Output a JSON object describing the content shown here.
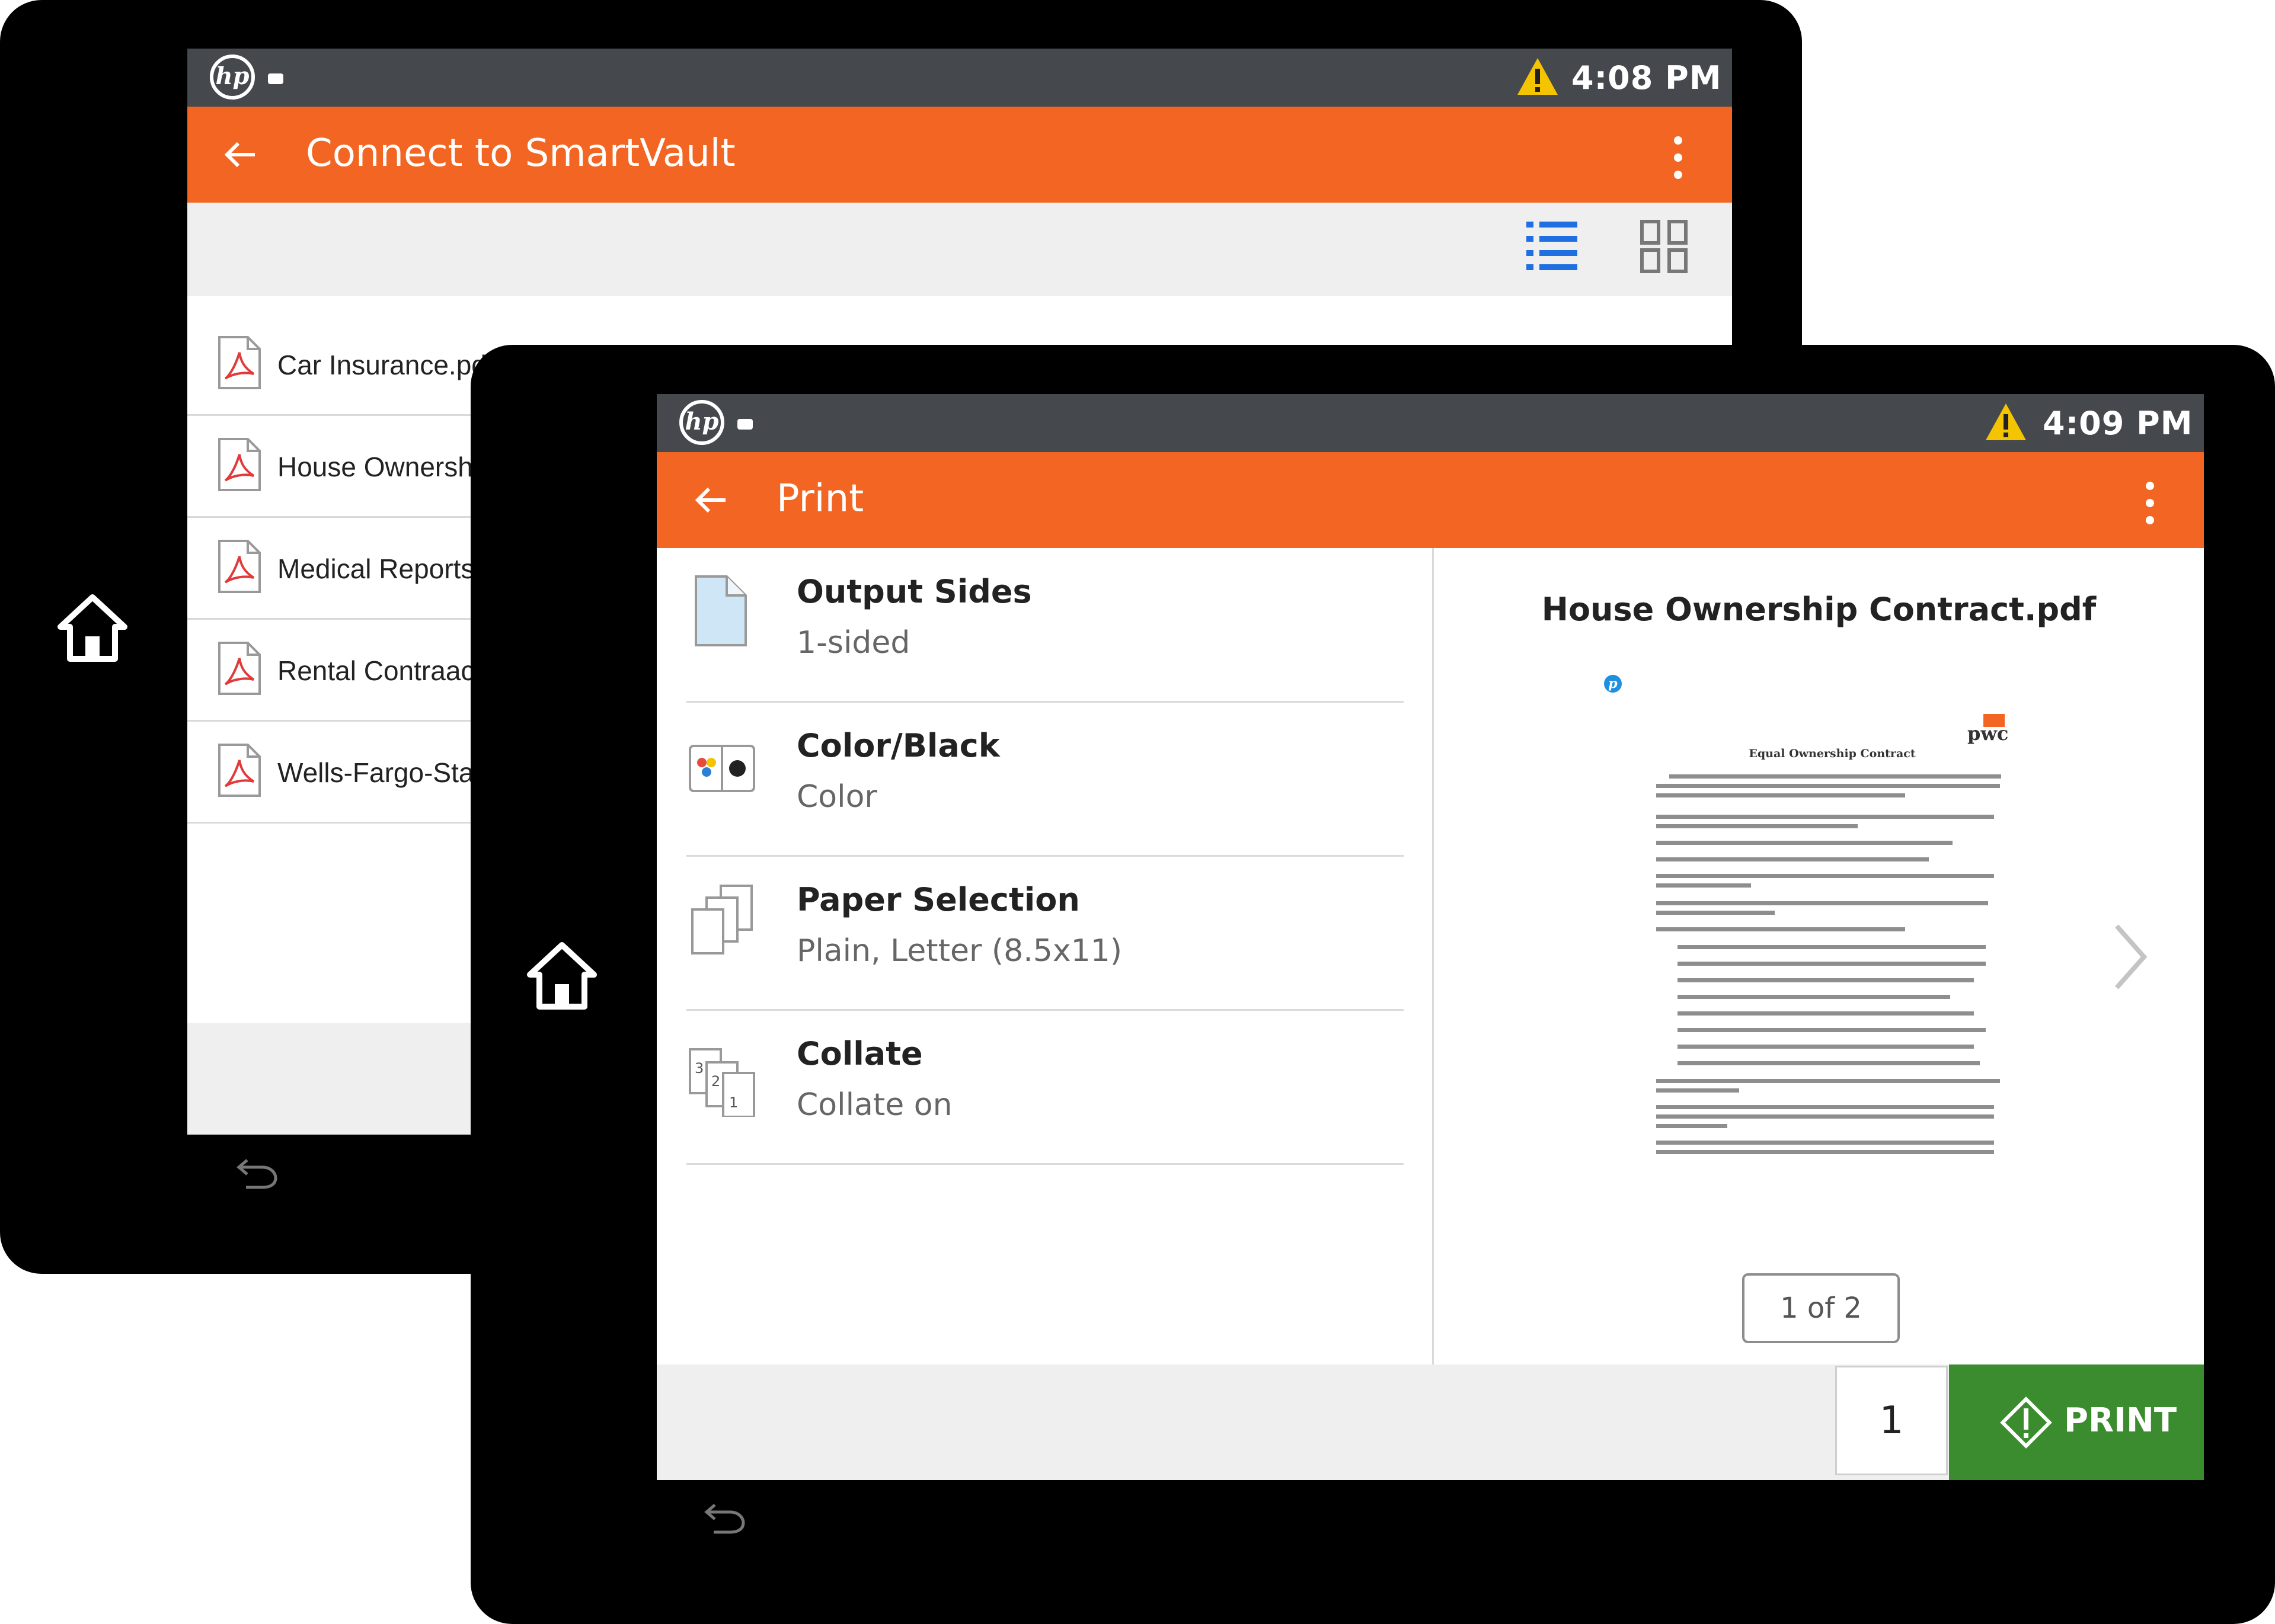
{
  "back_screen": {
    "status": {
      "time": "4:08 PM"
    },
    "title": "Connect to SmartVault",
    "files": [
      {
        "name": "Car Insurance.pdf"
      },
      {
        "name": "House Ownership Contract.pdf"
      },
      {
        "name": "Medical Reports.pdf"
      },
      {
        "name": "Rental Contraact.pdf"
      },
      {
        "name": "Wells-Fargo-Statement.pdf"
      }
    ],
    "icons": {
      "list_view": "list-view-icon",
      "grid_view": "grid-view-icon"
    }
  },
  "front_screen": {
    "status": {
      "time": "4:09 PM"
    },
    "title": "Print",
    "settings": [
      {
        "title": "Output Sides",
        "value": "1-sided",
        "icon": "output-sides-icon"
      },
      {
        "title": "Color/Black",
        "value": "Color",
        "icon": "color-black-icon"
      },
      {
        "title": "Paper Selection",
        "value": "Plain, Letter (8.5x11)",
        "icon": "paper-selection-icon"
      },
      {
        "title": "Collate",
        "value": "Collate on",
        "icon": "collate-icon"
      }
    ],
    "preview": {
      "file_name": "House Ownership Contract.pdf",
      "page_indicator": "1 of 2",
      "doc_brand": "pwc",
      "doc_heading": "Equal Ownership Contract"
    },
    "copies": "1",
    "print_label": "PRINT"
  },
  "colors": {
    "accent_orange": "#f26522",
    "status_bar": "#45484c",
    "print_green": "#3b8c2e",
    "view_blue": "#1f6fe0",
    "warning_yellow": "#f5c400"
  }
}
